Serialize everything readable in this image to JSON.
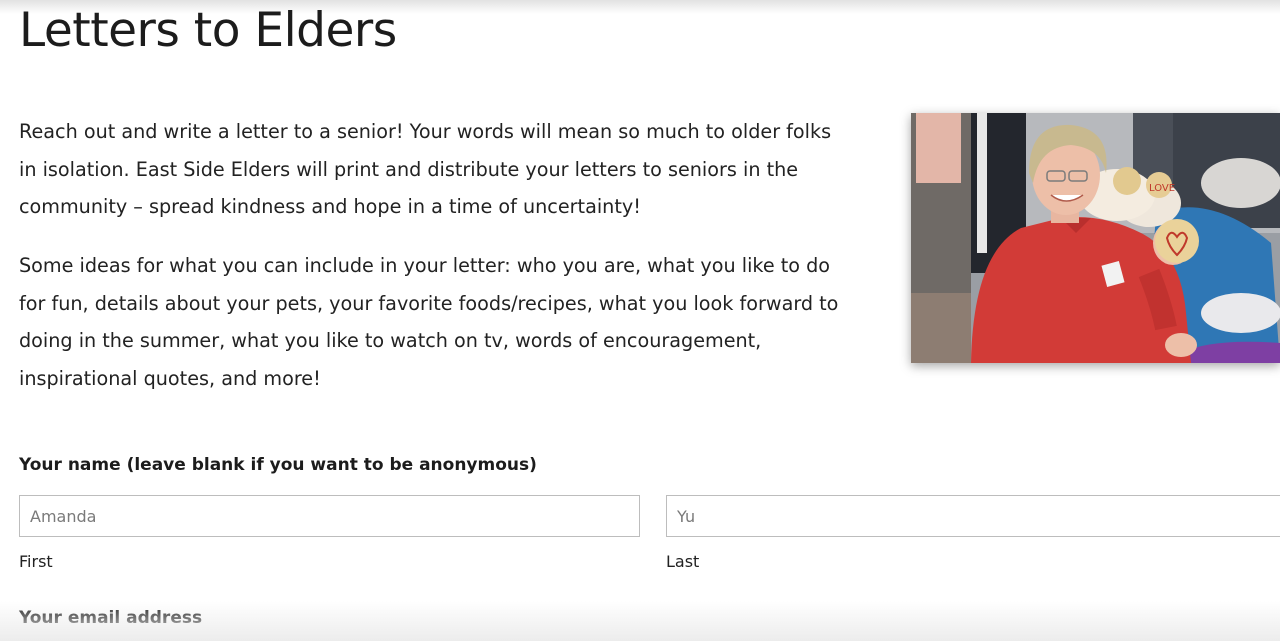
{
  "page": {
    "title": "Letters to Elders",
    "intro": "Reach out and write a letter to a senior!  Your words will mean so much to older folks in isolation.  East Side Elders will print and distribute your letters to seniors in the community – spread kindness and hope in a time of uncertainty!",
    "ideas": "Some ideas for what you can include in your letter:  who you are, what you like to do for fun, details about your pets, your favorite foods/recipes, what you look forward to doing in the summer, what you like to watch on tv, words of encouragement, inspirational quotes, and more!"
  },
  "photo": {
    "cookie_text": "LOVE"
  },
  "form": {
    "name_label": "Your name (leave blank if you want to be anonymous)",
    "first_name": {
      "placeholder": "Amanda",
      "sub_label": "First"
    },
    "last_name": {
      "placeholder": "Yu",
      "sub_label": "Last"
    },
    "email_label": "Your email address"
  },
  "colors": {
    "text": "#222222",
    "input_border": "#bdbdbd",
    "placeholder": "#7a7a7a",
    "sweater_red": "#d23b37"
  }
}
